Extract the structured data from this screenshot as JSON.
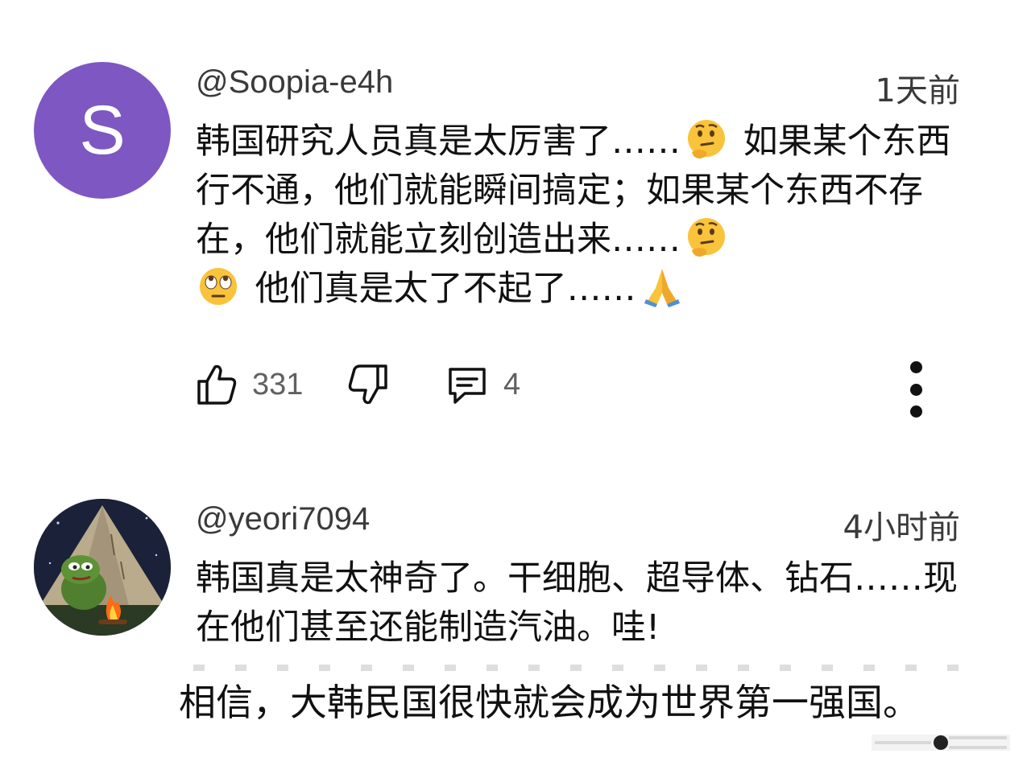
{
  "comments": [
    {
      "avatar_letter": "S",
      "avatar_color": "#7e57c2",
      "handle": "@Soopia-e4h",
      "time": "1天前",
      "text": {
        "seg1": "韩国研究人员真是太厉害了……",
        "emoji1": "thinking-face",
        "seg2": " 如果某个东西行不通，他们就能瞬间搞定；如果某个东西不存在，他们就能立刻创造出来……",
        "emoji2": "thinking-face",
        "emoji3": "rolling-eyes-face",
        "seg3": " 他们真是太了不起了……",
        "emoji4": "folded-hands"
      },
      "likes": "331",
      "replies": "4"
    },
    {
      "avatar_desc_icon": "frog-campfire-avatar",
      "handle": "@yeori7094",
      "time": "4小时前",
      "text": "韩国真是太神奇了。干细胞、超导体、钻石……现在他们甚至还能制造汽油。哇!"
    }
  ],
  "caption": "相信，大韩民国很快就会成为世界第一强国。",
  "icons": {
    "like": "thumbs-up-icon",
    "dislike": "thumbs-down-icon",
    "reply": "comment-icon",
    "more": "more-vertical-icon"
  },
  "colors": {
    "avatar_purple": "#7e57c2",
    "emoji_yellow": "#f9c33b"
  }
}
